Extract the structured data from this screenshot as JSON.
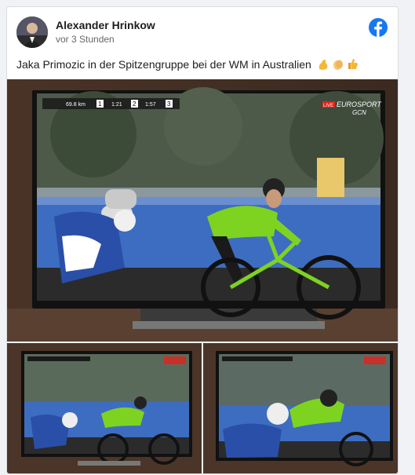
{
  "post": {
    "author": "Alexander Hrinkow",
    "time": "vor 3 Stunden",
    "text": "Jaka Primozic in der Spitzengruppe bei der WM in Australien",
    "emojis": [
      "flexed-biceps",
      "clapping-hands",
      "thumbs-up"
    ]
  },
  "broadcast": {
    "distance": "69.8 km",
    "group1": "1",
    "gap1": "1:21",
    "group2": "2",
    "gap2": "1:57",
    "group3": "3",
    "live": "LIVE",
    "channel": "EUROSPORT",
    "subchannel": "GCN"
  },
  "colors": {
    "facebook_blue": "#1877f2",
    "slovenia_jersey": "#7ed321",
    "french_jersey_blue": "#2a4fa8"
  },
  "icons": [
    "facebook-icon",
    "avatar"
  ]
}
